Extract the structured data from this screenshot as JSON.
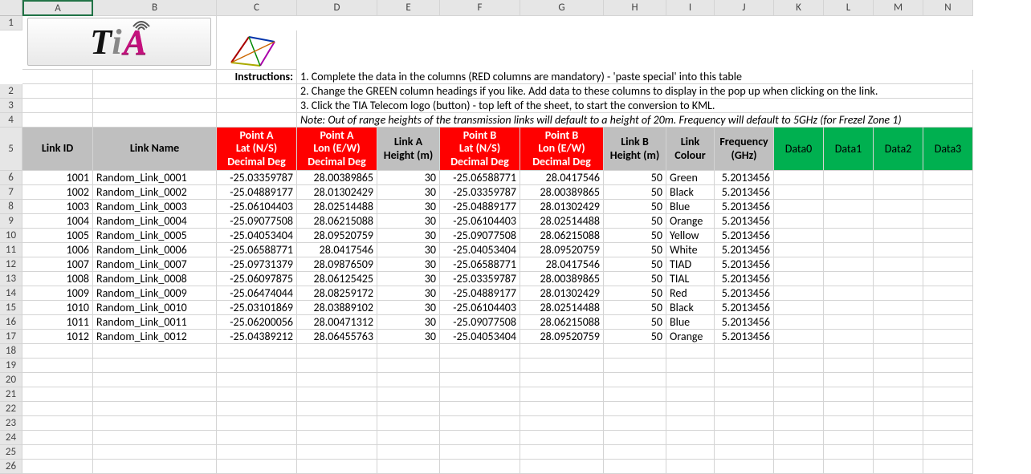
{
  "columns": [
    "A",
    "B",
    "C",
    "D",
    "E",
    "F",
    "G",
    "H",
    "I",
    "J",
    "K",
    "L",
    "M",
    "N"
  ],
  "row_count": 26,
  "instructions_label": "Instructions:",
  "instructions": [
    "1. Complete the data in the columns (RED columns are mandatory) - 'paste special' into this table",
    "2. Change the GREEN column headings if you like. Add data to these columns to display in the pop up when clicking on the link.",
    "3. Click the TIA Telecom logo (button) - top left of the sheet, to start the conversion to KML."
  ],
  "note": "Note: Out of range heights of the transmission links will default to a height of 20m. Frequency will default to 5GHz (for Frezel Zone 1)",
  "headers": {
    "link_id": "Link ID",
    "link_name": "Link Name",
    "pa_lat": "Point A\nLat (N/S)\nDecimal Deg",
    "pa_lon": "Point A\nLon (E/W)\nDecimal Deg",
    "a_height": "Link A\nHeight (m)",
    "pb_lat": "Point B\nLat (N/S)\nDecimal Deg",
    "pb_lon": "Point B\nLon (E/W)\nDecimal Deg",
    "b_height": "Link B\nHeight (m)",
    "colour": "Link\nColour",
    "freq": "Frequency\n(GHz)",
    "d0": "Data0",
    "d1": "Data1",
    "d2": "Data2",
    "d3": "Data3"
  },
  "rows": [
    {
      "id": "1001",
      "name": "Random_Link_0001",
      "alat": "-25.03359787",
      "alon": "28.00389865",
      "ah": "30",
      "blat": "-25.06588771",
      "blon": "28.0417546",
      "bh": "50",
      "col": "Green",
      "f": "5.2013456"
    },
    {
      "id": "1002",
      "name": "Random_Link_0002",
      "alat": "-25.04889177",
      "alon": "28.01302429",
      "ah": "30",
      "blat": "-25.03359787",
      "blon": "28.00389865",
      "bh": "50",
      "col": "Black",
      "f": "5.2013456"
    },
    {
      "id": "1003",
      "name": "Random_Link_0003",
      "alat": "-25.06104403",
      "alon": "28.02514488",
      "ah": "30",
      "blat": "-25.04889177",
      "blon": "28.01302429",
      "bh": "50",
      "col": "Blue",
      "f": "5.2013456"
    },
    {
      "id": "1004",
      "name": "Random_Link_0004",
      "alat": "-25.09077508",
      "alon": "28.06215088",
      "ah": "30",
      "blat": "-25.06104403",
      "blon": "28.02514488",
      "bh": "50",
      "col": "Orange",
      "f": "5.2013456"
    },
    {
      "id": "1005",
      "name": "Random_Link_0005",
      "alat": "-25.04053404",
      "alon": "28.09520759",
      "ah": "30",
      "blat": "-25.09077508",
      "blon": "28.06215088",
      "bh": "50",
      "col": "Yellow",
      "f": "5.2013456"
    },
    {
      "id": "1006",
      "name": "Random_Link_0006",
      "alat": "-25.06588771",
      "alon": "28.0417546",
      "ah": "30",
      "blat": "-25.04053404",
      "blon": "28.09520759",
      "bh": "50",
      "col": "White",
      "f": "5.2013456"
    },
    {
      "id": "1007",
      "name": "Random_Link_0007",
      "alat": "-25.09731379",
      "alon": "28.09876509",
      "ah": "30",
      "blat": "-25.06588771",
      "blon": "28.0417546",
      "bh": "50",
      "col": "TIAD",
      "f": "5.2013456"
    },
    {
      "id": "1008",
      "name": "Random_Link_0008",
      "alat": "-25.06097875",
      "alon": "28.06125425",
      "ah": "30",
      "blat": "-25.03359787",
      "blon": "28.00389865",
      "bh": "50",
      "col": "TIAL",
      "f": "5.2013456"
    },
    {
      "id": "1009",
      "name": "Random_Link_0009",
      "alat": "-25.06474044",
      "alon": "28.08259172",
      "ah": "30",
      "blat": "-25.04889177",
      "blon": "28.01302429",
      "bh": "50",
      "col": "Red",
      "f": "5.2013456"
    },
    {
      "id": "1010",
      "name": "Random_Link_0010",
      "alat": "-25.03101869",
      "alon": "28.03889102",
      "ah": "30",
      "blat": "-25.06104403",
      "blon": "28.02514488",
      "bh": "50",
      "col": "Black",
      "f": "5.2013456"
    },
    {
      "id": "1011",
      "name": "Random_Link_0011",
      "alat": "-25.06200056",
      "alon": "28.00471312",
      "ah": "30",
      "blat": "-25.09077508",
      "blon": "28.06215088",
      "bh": "50",
      "col": "Blue",
      "f": "5.2013456"
    },
    {
      "id": "1012",
      "name": "Random_Link_0012",
      "alat": "-25.04389212",
      "alon": "28.06455763",
      "ah": "30",
      "blat": "-25.04053404",
      "blon": "28.09520759",
      "bh": "50",
      "col": "Orange",
      "f": "5.2013456"
    }
  ],
  "logo": {
    "text1": "T",
    "text2": "i",
    "text3": "A"
  }
}
